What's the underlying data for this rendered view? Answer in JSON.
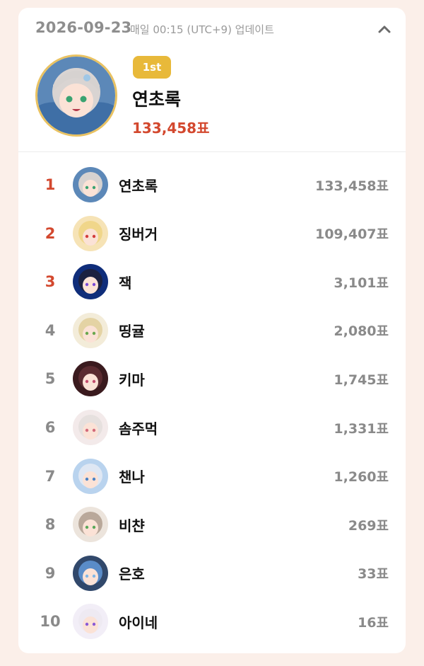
{
  "header": {
    "date": "2026-09-23",
    "update_note": "매일 00:15 (UTC+9) 업데이트"
  },
  "top": {
    "badge": "1st",
    "name": "연초록",
    "votes": "133,458표"
  },
  "ranking": [
    {
      "rank": "1",
      "name": "연초록",
      "votes": "133,458표",
      "bg": "#5c88b8",
      "hair": "#d6d2d0",
      "eye": "#3aa371"
    },
    {
      "rank": "2",
      "name": "징버거",
      "votes": "109,407표",
      "bg": "#f6e3b6",
      "hair": "#f0d68a",
      "eye": "#d33c3c"
    },
    {
      "rank": "3",
      "name": "잭",
      "votes": "3,101표",
      "bg": "#0f2d7a",
      "hair": "#1b2140",
      "eye": "#7a4bd6"
    },
    {
      "rank": "4",
      "name": "띵귤",
      "votes": "2,080표",
      "bg": "#f3ecd9",
      "hair": "#e4d3a4",
      "eye": "#6aa84f"
    },
    {
      "rank": "5",
      "name": "키마",
      "votes": "1,745표",
      "bg": "#3a1a1e",
      "hair": "#5b2b30",
      "eye": "#c44d6e"
    },
    {
      "rank": "6",
      "name": "솜주먹",
      "votes": "1,331표",
      "bg": "#f3eaea",
      "hair": "#e6e0de",
      "eye": "#d36a7a"
    },
    {
      "rank": "7",
      "name": "챈나",
      "votes": "1,260표",
      "bg": "#b9d3ee",
      "hair": "#dfe7f3",
      "eye": "#4a82c6"
    },
    {
      "rank": "8",
      "name": "비챤",
      "votes": "269표",
      "bg": "#ece4dc",
      "hair": "#b9a89a",
      "eye": "#5aa85a"
    },
    {
      "rank": "9",
      "name": "은호",
      "votes": "33표",
      "bg": "#31486b",
      "hair": "#5a8cc8",
      "eye": "#7fb7e8"
    },
    {
      "rank": "10",
      "name": "아이네",
      "votes": "16표",
      "bg": "#f2eef7",
      "hair": "#eeeaf2",
      "eye": "#8a5ad6"
    }
  ],
  "colors": {
    "accent": "#d3482e",
    "badge": "#e8b93a",
    "avatar_ring": "#e9c262",
    "muted": "#8a8a8a"
  },
  "icons": {
    "collapse": "chevron-up-icon"
  }
}
